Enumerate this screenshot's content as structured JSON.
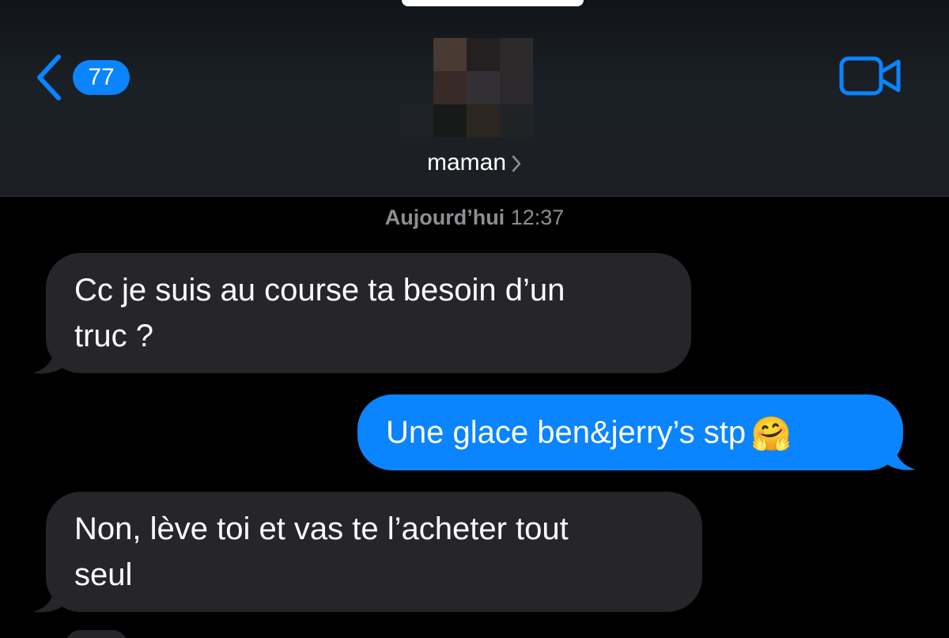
{
  "header": {
    "back_badge_count": "77",
    "contact_name": "maman",
    "icons": {
      "back": "chevron-left-icon",
      "video": "video-camera-icon",
      "details": "chevron-right-icon"
    }
  },
  "conversation": {
    "timestamp_day": "Aujourd’hui",
    "timestamp_time": "12:37",
    "messages": [
      {
        "direction": "received",
        "lines": [
          "Cc je suis au course ta besoin d’un",
          "truc ?"
        ]
      },
      {
        "direction": "sent",
        "text": "Une glace ben&jerry’s stp",
        "emoji": "🤗"
      },
      {
        "direction": "received",
        "lines": [
          "Non, lève toi et vas te l’acheter tout",
          "seul"
        ]
      }
    ]
  },
  "colors": {
    "accent": "#0a84ff",
    "received_bubble": "#26252a",
    "timestamp_text": "#8e8e93",
    "background": "#000000"
  }
}
